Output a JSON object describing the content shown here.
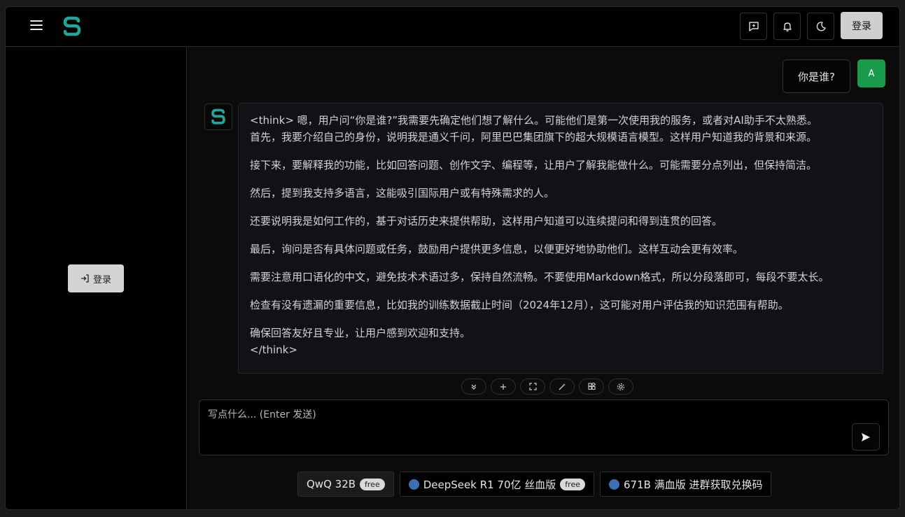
{
  "header": {
    "login_label": "登录",
    "icons": [
      "feedback-icon",
      "bell-icon",
      "moon-icon"
    ]
  },
  "sidebar": {
    "login_label": "登录"
  },
  "chat": {
    "user_message": "你是谁?",
    "user_avatar": "A",
    "bot_paragraphs": [
      "<think> 嗯，用户问“你是谁?”我需要先确定他们想了解什么。可能他们是第一次使用我的服务，或者对AI助手不太熟悉。",
      "首先，我要介绍自己的身份，说明我是通义千问，阿里巴巴集团旗下的超大规模语言模型。这样用户知道我的背景和来源。",
      "接下来，要解释我的功能，比如回答问题、创作文字、编程等，让用户了解我能做什么。可能需要分点列出，但保持简洁。",
      "然后，提到我支持多语言，这能吸引国际用户或有特殊需求的人。",
      "还要说明我是如何工作的，基于对话历史来提供帮助，这样用户知道可以连续提问和得到连贯的回答。",
      "最后，询问是否有具体问题或任务，鼓励用户提供更多信息，以便更好地协助他们。这样互动会更有效率。",
      "需要注意用口语化的中文，避免技术术语过多，保持自然流畅。不要使用Markdown格式，所以分段落即可，每段不要太长。",
      "检查有没有遗漏的重要信息，比如我的训练数据截止时间（2024年12月），这可能对用户评估我的知识范围有帮助。",
      "确保回答友好且专业，让用户感到欢迎和支持。",
      "</think>"
    ]
  },
  "toolbar": {
    "icons": [
      "chevrons-down-icon",
      "plus-icon",
      "fullscreen-icon",
      "magic-wand-icon",
      "apps-icon",
      "settings-icon"
    ]
  },
  "composer": {
    "placeholder": "写点什么... (Enter 发送)"
  },
  "models": [
    {
      "label": "QwQ 32B",
      "badge": "free"
    },
    {
      "label": "DeepSeek R1 70亿 丝血版",
      "badge": "free"
    },
    {
      "label": "671B 满血版 进群获取兑换码",
      "badge": ""
    }
  ],
  "colors": {
    "accent_green": "#1a9b4c",
    "logo_teal": "#1fa89a"
  }
}
